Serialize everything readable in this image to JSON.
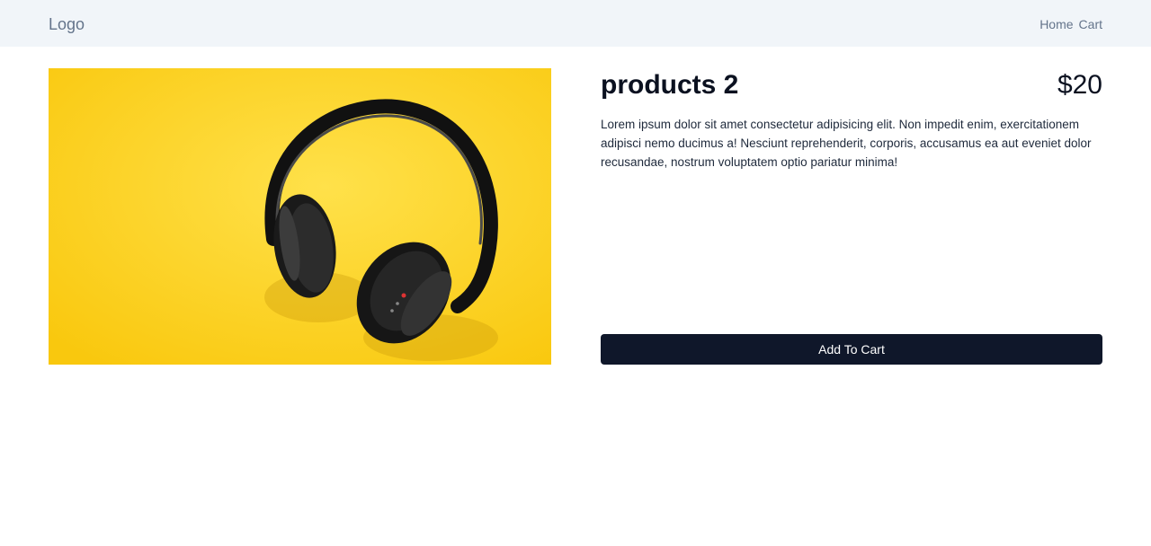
{
  "header": {
    "logo": "Logo",
    "nav": [
      "Home",
      "Cart"
    ]
  },
  "product": {
    "title": "products 2",
    "price": "$20",
    "description": "Lorem ipsum dolor sit amet consectetur adipisicing elit. Non impedit enim, exercitationem adipisci nemo ducimus a! Nesciunt reprehenderit, corporis, accusamus ea aut eveniet dolor recusandae, nostrum voluptatem optio pariatur minima!",
    "image_icon": "headphones-photo",
    "add_to_cart_label": "Add To Cart"
  },
  "colors": {
    "header_bg": "#f1f5f9",
    "button_bg": "#0f172a",
    "image_bg": "#fcd117"
  }
}
